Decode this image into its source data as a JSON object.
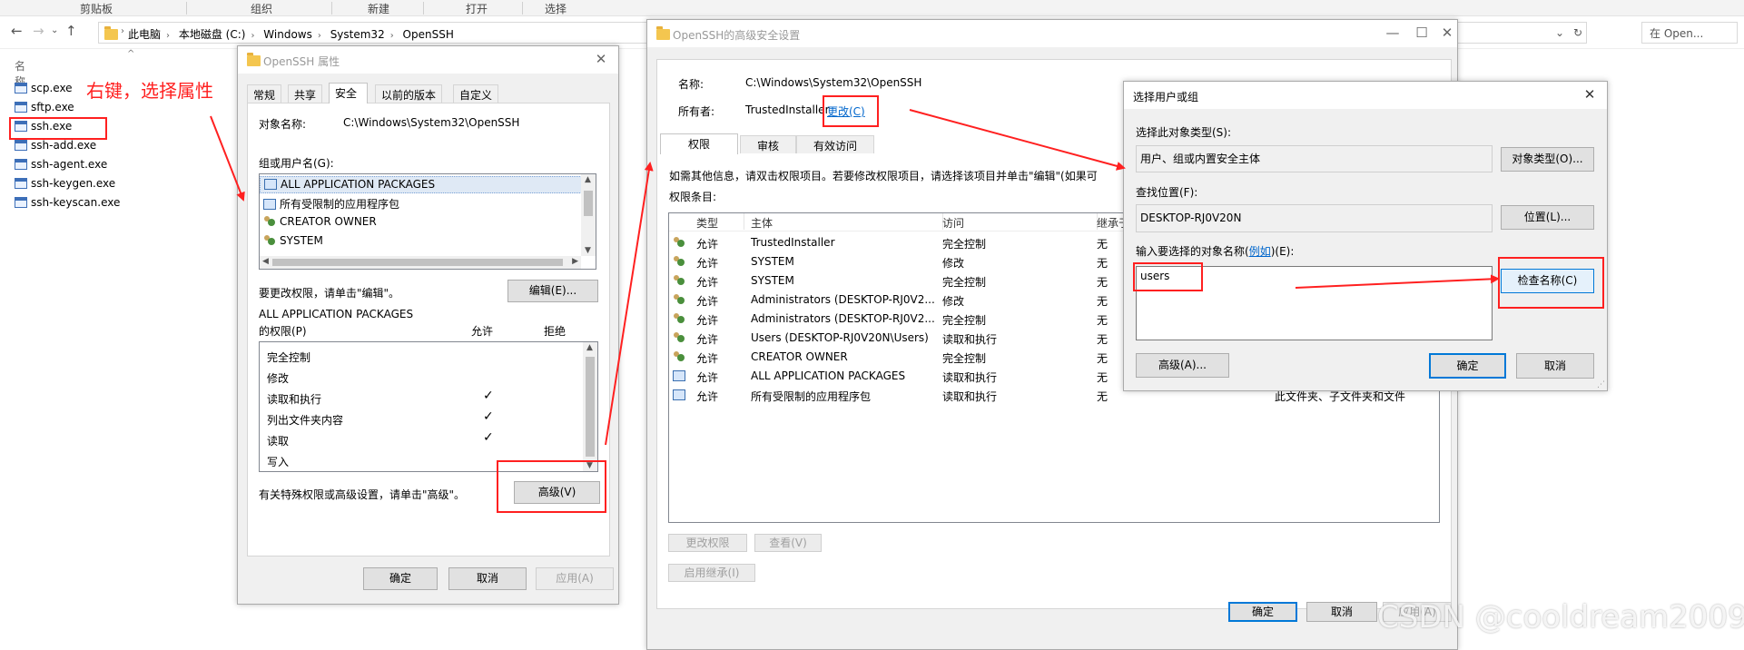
{
  "ribbon": {
    "groups": [
      "剪贴板",
      "组织",
      "新建",
      "打开",
      "选择"
    ]
  },
  "address": {
    "crumbs": [
      "此电脑",
      "本地磁盘 (C:)",
      "Windows",
      "System32",
      "OpenSSH"
    ],
    "search_placeholder": "在 Open..."
  },
  "explorer": {
    "column_name": "名称",
    "files": [
      "scp.exe",
      "sftp.exe",
      "ssh.exe",
      "ssh-add.exe",
      "ssh-agent.exe",
      "ssh-keygen.exe",
      "ssh-keyscan.exe"
    ],
    "annotation": "右键，选择属性"
  },
  "props": {
    "title": "OpenSSH 属性",
    "tabs": [
      "常规",
      "共享",
      "安全",
      "以前的版本",
      "自定义"
    ],
    "object_label": "对象名称:",
    "object_value": "C:\\Windows\\System32\\OpenSSH",
    "groups_label": "组或用户名(G):",
    "groups": [
      "ALL APPLICATION PACKAGES",
      "所有受限制的应用程序包",
      "CREATOR OWNER",
      "SYSTEM"
    ],
    "change_hint": "要更改权限，请单击\"编辑\"。",
    "edit_button": "编辑(E)...",
    "perm_for_line1": "ALL APPLICATION PACKAGES",
    "perm_for_line2": "的权限(P)",
    "allow_header": "允许",
    "deny_header": "拒绝",
    "permissions": [
      {
        "name": "完全控制",
        "allow": false
      },
      {
        "name": "修改",
        "allow": false
      },
      {
        "name": "读取和执行",
        "allow": true
      },
      {
        "name": "列出文件夹内容",
        "allow": true
      },
      {
        "name": "读取",
        "allow": true
      },
      {
        "name": "写入",
        "allow": false
      }
    ],
    "check_mark": "✓",
    "advanced_hint": "有关特殊权限或高级设置，请单击\"高级\"。",
    "advanced_button": "高级(V)",
    "ok": "确定",
    "cancel": "取消",
    "apply": "应用(A)"
  },
  "advanced": {
    "title": "OpenSSH的高级安全设置",
    "name_label": "名称:",
    "name_value": "C:\\Windows\\System32\\OpenSSH",
    "owner_label": "所有者:",
    "owner_value": "TrustedInstaller",
    "change_link": "更改(C)",
    "tabs": [
      "权限",
      "审核",
      "有效访问"
    ],
    "info": "如需其他信息，请双击权限项目。若要修改权限项目，请选择该项目并单击\"编辑\"(如果可",
    "entries_label": "权限条目:",
    "columns": [
      "类型",
      "主体",
      "访问",
      "继承于"
    ],
    "entries": [
      {
        "type": "允许",
        "principal": "TrustedInstaller",
        "access": "完全控制",
        "inherit": "无",
        "icon": "user"
      },
      {
        "type": "允许",
        "principal": "SYSTEM",
        "access": "修改",
        "inherit": "无",
        "icon": "user"
      },
      {
        "type": "允许",
        "principal": "SYSTEM",
        "access": "完全控制",
        "inherit": "无",
        "icon": "user"
      },
      {
        "type": "允许",
        "principal": "Administrators (DESKTOP-RJ0V2...",
        "access": "修改",
        "inherit": "无",
        "icon": "user"
      },
      {
        "type": "允许",
        "principal": "Administrators (DESKTOP-RJ0V2...",
        "access": "完全控制",
        "inherit": "无",
        "icon": "user"
      },
      {
        "type": "允许",
        "principal": "Users (DESKTOP-RJ0V20N\\Users)",
        "access": "读取和执行",
        "inherit": "无",
        "icon": "user"
      },
      {
        "type": "允许",
        "principal": "CREATOR OWNER",
        "access": "完全控制",
        "inherit": "无",
        "icon": "user"
      },
      {
        "type": "允许",
        "principal": "ALL APPLICATION PACKAGES",
        "access": "读取和执行",
        "inherit": "无",
        "icon": "pkg"
      },
      {
        "type": "允许",
        "principal": "所有受限制的应用程序包",
        "access": "读取和执行",
        "inherit": "无",
        "icon": "pkg"
      }
    ],
    "applies_to_last": "此文件夹、子文件夹和文件",
    "change_perm": "更改权限",
    "view": "查看(V)",
    "enable_inherit": "启用继承(I)",
    "ok": "确定",
    "cancel": "取消",
    "apply": "应用(A)"
  },
  "select": {
    "title": "选择用户或组",
    "type_label": "选择此对象类型(S):",
    "type_value": "用户、组或内置安全主体",
    "object_types_button": "对象类型(O)...",
    "location_label": "查找位置(F):",
    "location_value": "DESKTOP-RJ0V20N",
    "location_button": "位置(L)...",
    "enter_label_prefix": "输入要选择的对象名称(",
    "enter_label_link": "例如",
    "enter_label_suffix": ")(E):",
    "input_value": "users",
    "check_names": "检查名称(C)",
    "advanced": "高级(A)...",
    "ok": "确定",
    "cancel": "取消"
  },
  "watermark": "CSDN @cooldream2009",
  "colors": {
    "annotation_red": "#ff2020",
    "accent_blue": "#0078d7"
  }
}
